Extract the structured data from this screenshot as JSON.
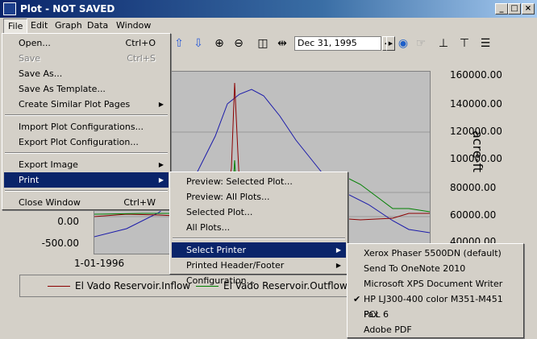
{
  "window": {
    "title": "Plot - NOT SAVED"
  },
  "menubar": [
    "File",
    "Edit",
    "Graph",
    "Data",
    "Window"
  ],
  "toolbar": {
    "date": "Dec 31, 1995"
  },
  "plot": {
    "left_ticks": [
      "0.00",
      "-500.00"
    ],
    "right_ticks": [
      "160000.00",
      "140000.00",
      "120000.00",
      "100000.00",
      "80000.00",
      "60000.00",
      "40000.00"
    ],
    "y_unit": "acre-ft",
    "x_tick": "1-01-1996",
    "legend": [
      "El Vado Reservoir.Inflow",
      "El Vado Reservoir.Outflow"
    ],
    "colors": {
      "inflow": "#8b0000",
      "outflow": "#008000",
      "storage": "#1a1aaa"
    }
  },
  "file_menu": {
    "items": [
      {
        "label": "Open...",
        "shortcut": "Ctrl+O"
      },
      {
        "label": "Save",
        "shortcut": "Ctrl+S",
        "disabled": true
      },
      {
        "label": "Save As..."
      },
      {
        "label": "Save As Template..."
      },
      {
        "label": "Create Similar Plot Pages",
        "submenu": true
      },
      {
        "label": "Import Plot Configurations..."
      },
      {
        "label": "Export Plot Configuration..."
      },
      {
        "label": "Export Image",
        "submenu": true
      },
      {
        "label": "Print",
        "submenu": true,
        "selected": true
      },
      {
        "label": "Close Window",
        "shortcut": "Ctrl+W"
      }
    ]
  },
  "print_menu": {
    "items": [
      {
        "label": "Preview: Selected Plot..."
      },
      {
        "label": "Preview: All Plots..."
      },
      {
        "label": "Selected Plot..."
      },
      {
        "label": "All Plots..."
      },
      {
        "label": "Select Printer",
        "submenu": true,
        "selected": true
      },
      {
        "label": "Printed Header/Footer Configuration...",
        "submenu": true
      }
    ]
  },
  "printer_menu": {
    "items": [
      {
        "label": "Xerox Phaser 5500DN (default)"
      },
      {
        "label": "Send To OneNote 2010"
      },
      {
        "label": "Microsoft XPS Document Writer"
      },
      {
        "label": "HP LJ300-400 color M351-M451 PCL 6",
        "checked": true
      },
      {
        "label": "Fax"
      },
      {
        "label": "Adobe PDF"
      }
    ]
  }
}
